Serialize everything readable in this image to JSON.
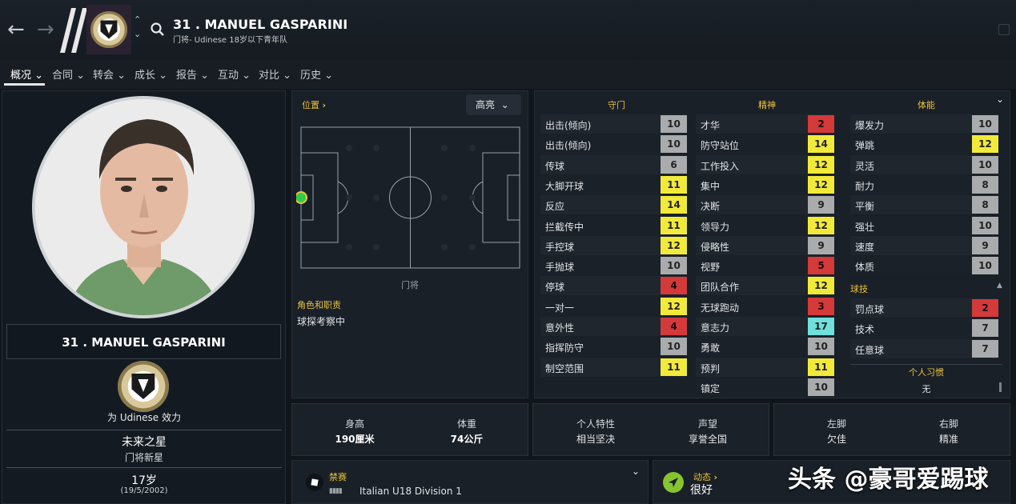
{
  "header": {
    "back_icon": "arrow-left-icon",
    "forward_icon": "arrow-right-icon",
    "player_title": "31 . MANUEL GASPARINI",
    "subtitle": "门将- Udinese 18岁以下青年队"
  },
  "menu": [
    {
      "label": "概况"
    },
    {
      "label": "合同"
    },
    {
      "label": "转会"
    },
    {
      "label": "成长"
    },
    {
      "label": "报告"
    },
    {
      "label": "互动"
    },
    {
      "label": "对比"
    },
    {
      "label": "历史"
    }
  ],
  "profile": {
    "name": "31 . MANUEL GASPARINI",
    "plays_for": "为 Udinese 效力",
    "status_title": "未来之星",
    "status_sub": "门将新星",
    "age": "17岁",
    "dob": "(19/5/2002)"
  },
  "position_panel": {
    "title": "位置",
    "highlight": "高亮",
    "position_label": "门将",
    "role_title": "角色和职责",
    "role_value": "球探考察中"
  },
  "attributes": {
    "goalkeeping_title": "守门",
    "mental_title": "精神",
    "physical_title": "体能",
    "technical_title": "球技",
    "habits_title": "个人习惯",
    "habits_value": "无",
    "goalkeeping": [
      {
        "name": "出击(倾向)",
        "value": "10",
        "color": "#a9abad"
      },
      {
        "name": "出击(倾向)",
        "value": "10",
        "color": "#a9abad"
      },
      {
        "name": "传球",
        "value": "6",
        "color": "#a9abad"
      },
      {
        "name": "大脚开球",
        "value": "11",
        "color": "#f2ea3a"
      },
      {
        "name": "反应",
        "value": "14",
        "color": "#f2ea3a"
      },
      {
        "name": "拦截传中",
        "value": "11",
        "color": "#f2ea3a"
      },
      {
        "name": "手控球",
        "value": "12",
        "color": "#f2ea3a"
      },
      {
        "name": "手抛球",
        "value": "10",
        "color": "#a9abad"
      },
      {
        "name": "停球",
        "value": "4",
        "color": "#d43a3a"
      },
      {
        "name": "一对一",
        "value": "12",
        "color": "#f2ea3a"
      },
      {
        "name": "意外性",
        "value": "4",
        "color": "#d43a3a"
      },
      {
        "name": "指挥防守",
        "value": "10",
        "color": "#a9abad"
      },
      {
        "name": "制空范围",
        "value": "11",
        "color": "#f2ea3a"
      }
    ],
    "mental": [
      {
        "name": "才华",
        "value": "2",
        "color": "#d43a3a"
      },
      {
        "name": "防守站位",
        "value": "14",
        "color": "#f2ea3a"
      },
      {
        "name": "工作投入",
        "value": "12",
        "color": "#f2ea3a"
      },
      {
        "name": "集中",
        "value": "12",
        "color": "#f2ea3a"
      },
      {
        "name": "决断",
        "value": "9",
        "color": "#a9abad"
      },
      {
        "name": "领导力",
        "value": "12",
        "color": "#f2ea3a"
      },
      {
        "name": "侵略性",
        "value": "9",
        "color": "#a9abad"
      },
      {
        "name": "视野",
        "value": "5",
        "color": "#d43a3a"
      },
      {
        "name": "团队合作",
        "value": "12",
        "color": "#f2ea3a"
      },
      {
        "name": "无球跑动",
        "value": "3",
        "color": "#d43a3a"
      },
      {
        "name": "意志力",
        "value": "17",
        "color": "#6fe0dc"
      },
      {
        "name": "勇敢",
        "value": "10",
        "color": "#a9abad"
      },
      {
        "name": "预判",
        "value": "11",
        "color": "#f2ea3a"
      },
      {
        "name": "镇定",
        "value": "10",
        "color": "#a9abad"
      }
    ],
    "physical": [
      {
        "name": "爆发力",
        "value": "10",
        "color": "#a9abad"
      },
      {
        "name": "弹跳",
        "value": "12",
        "color": "#f2ea3a"
      },
      {
        "name": "灵活",
        "value": "10",
        "color": "#a9abad"
      },
      {
        "name": "耐力",
        "value": "8",
        "color": "#a9abad"
      },
      {
        "name": "平衡",
        "value": "8",
        "color": "#a9abad"
      },
      {
        "name": "强壮",
        "value": "10",
        "color": "#a9abad"
      },
      {
        "name": "速度",
        "value": "9",
        "color": "#a9abad"
      },
      {
        "name": "体质",
        "value": "10",
        "color": "#a9abad"
      }
    ],
    "technical": [
      {
        "name": "罚点球",
        "value": "2",
        "color": "#d43a3a"
      },
      {
        "name": "技术",
        "value": "7",
        "color": "#a9abad"
      },
      {
        "name": "任意球",
        "value": "7",
        "color": "#a9abad"
      }
    ]
  },
  "info": {
    "height_label": "身高",
    "height_value": "190厘米",
    "weight_label": "体重",
    "weight_value": "74公斤",
    "personality_label": "个人特性",
    "personality_value": "相当坚决",
    "reputation_label": "声望",
    "reputation_value": "享誉全国",
    "left_foot_label": "左脚",
    "left_foot_value": "欠佳",
    "right_foot_label": "右脚",
    "right_foot_value": "精准"
  },
  "bottom": {
    "ban_title": "禁赛",
    "competition": "Italian U18 Division 1",
    "dynamic_title": "动态",
    "morale": "很好",
    "watermark": "头条 @豪哥爱踢球"
  }
}
